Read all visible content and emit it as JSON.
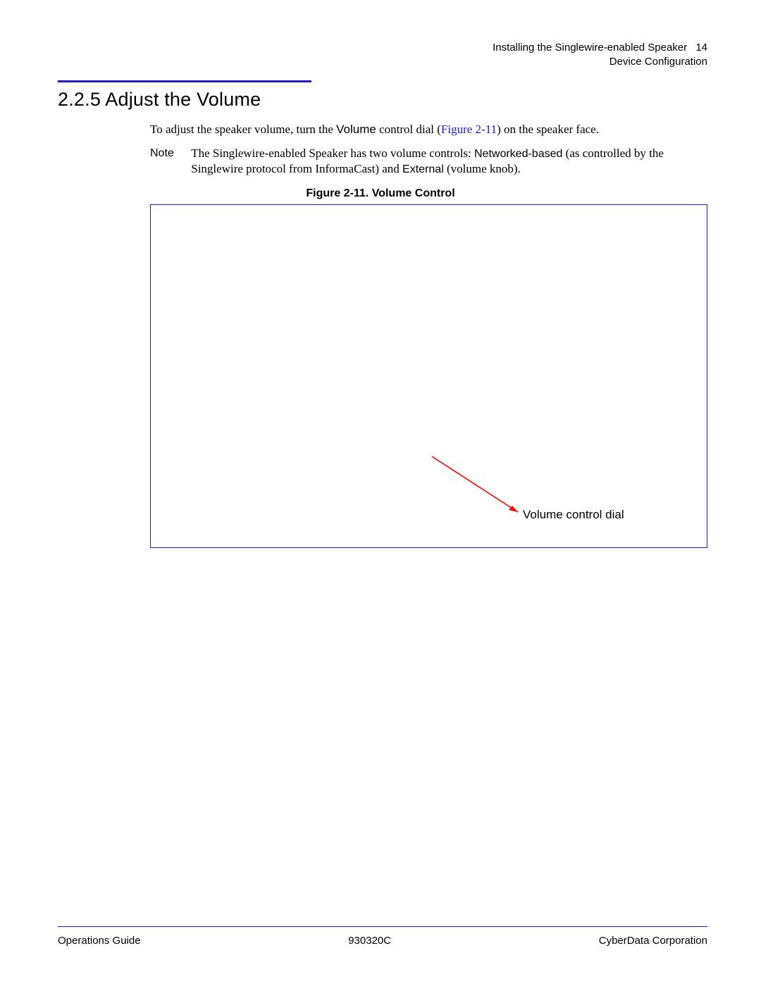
{
  "header": {
    "line1_text": "Installing the Singlewire-enabled Speaker",
    "page_number": "14",
    "line2_text": "Device Configuration"
  },
  "section": {
    "number": "2.2.5",
    "title": "Adjust the Volume"
  },
  "body": {
    "p1_pre": "To adjust the speaker volume, turn the ",
    "p1_volume": "Volume",
    "p1_mid": " control dial (",
    "p1_figref": "Figure 2-11",
    "p1_post": ") on the speaker face."
  },
  "note": {
    "label": "Note",
    "t1": "The Singlewire-enabled Speaker has two volume controls: ",
    "nb": "Networked-based",
    "t2": " (as controlled by the Singlewire protocol from InformaCast) and ",
    "ext": "External",
    "t3": " (volume knob)."
  },
  "figure": {
    "caption": "Figure 2-11. Volume Control",
    "callout": "Volume control dial"
  },
  "footer": {
    "left": "Operations Guide",
    "center": "930320C",
    "right": "CyberData Corporation"
  }
}
